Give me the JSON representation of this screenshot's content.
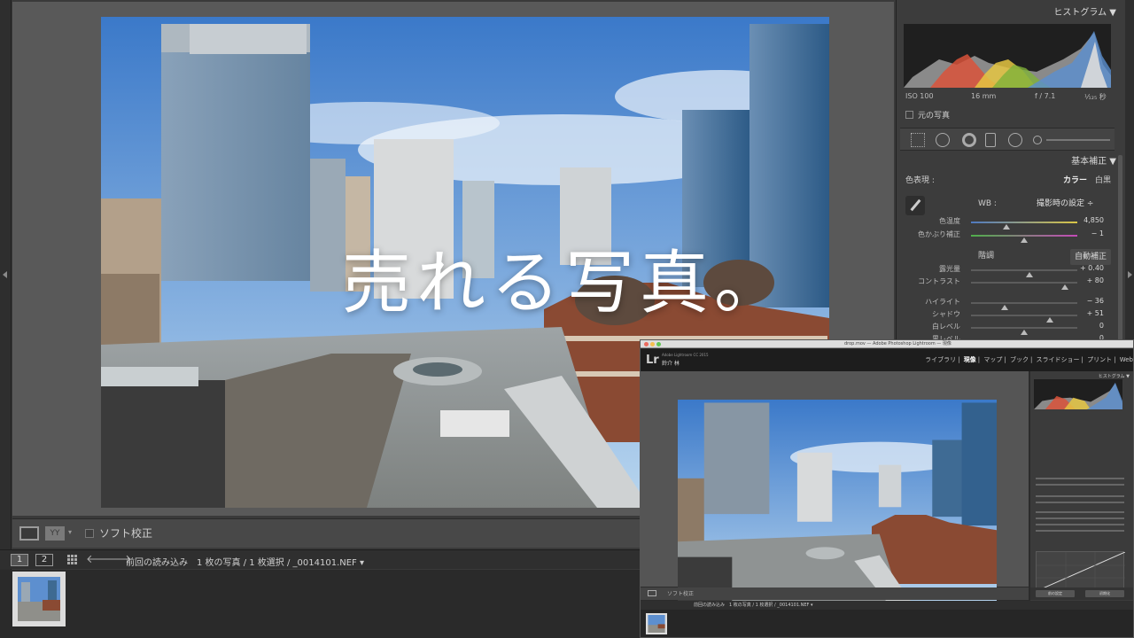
{
  "overlay": {
    "caption": "売れる写真。"
  },
  "toolbar": {
    "soft_proof_label": "ソフト校正",
    "compare_label": "YY"
  },
  "filmstrip": {
    "page_1": "1",
    "page_2": "2",
    "back_glyph": "🡐",
    "forward_glyph": "🡒",
    "source_path": "前回の読み込み　1 枚の写真 / 1 枚選択 / _0014101.NEF ▾"
  },
  "histogram": {
    "header": "ヒストグラム ▼",
    "iso": "ISO 100",
    "focal": "16 mm",
    "fstop": "f / 7.1",
    "shutter": "¹⁄₁₂₅ 秒",
    "original_photo_label": "元の写真"
  },
  "basic": {
    "header": "基本補正 ▼",
    "treatment_label": "色表現 :",
    "treatment_color": "カラー",
    "treatment_bw": "白黒",
    "wb_label": "WB :",
    "wb_value": "撮影時の設定 ÷",
    "tone_label": "階調",
    "auto_label": "自動補正",
    "sliders": [
      {
        "label": "色温度",
        "value": "4,850",
        "pos": 0.33
      },
      {
        "label": "色かぶり補正",
        "value": "− 1",
        "pos": 0.5
      },
      {
        "label": "露光量",
        "value": "+ 0.40",
        "pos": 0.55
      },
      {
        "label": "コントラスト",
        "value": "+ 80",
        "pos": 0.88
      },
      {
        "label": "ハイライト",
        "value": "− 36",
        "pos": 0.32
      },
      {
        "label": "シャドウ",
        "value": "+ 51",
        "pos": 0.74
      },
      {
        "label": "白レベル",
        "value": "0",
        "pos": 0.5
      },
      {
        "label": "黒レベル",
        "value": "0",
        "pos": 0.5
      }
    ]
  },
  "inset": {
    "window_title": "drop.mov — Adobe Photoshop Lightroom — 現像",
    "logo": "Lr",
    "product": "Adobe Lightroom CC 2015",
    "user": "鈴介 林",
    "modules": [
      "ライブラリ",
      "現像",
      "マップ",
      "ブック",
      "スライドショー",
      "プリント",
      "Web"
    ],
    "active_module": "現像",
    "soft_proof_label": "ソフト校正",
    "path": "前回の読み込み　1 枚の写真 / 1 枚選択 / _0014101.NEF ▾",
    "hist_header": "ヒストグラム ▼",
    "prev_button": "前の設定",
    "reset_button": "初期化"
  },
  "colors": {
    "sky_top": "#3b79c9",
    "sky_bottom": "#9ec6ea",
    "brick": "#8a4a33",
    "panel_bg": "#3c3c3c",
    "hist_red": "#d9523a",
    "hist_green": "#7fb23a",
    "hist_yellow": "#e5c542",
    "hist_blue": "#5a8ed0"
  }
}
